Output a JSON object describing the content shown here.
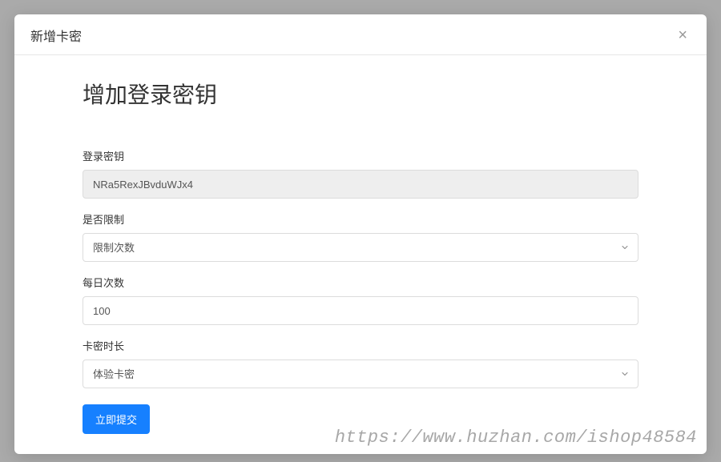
{
  "modal": {
    "title": "新增卡密"
  },
  "form": {
    "heading": "增加登录密钥",
    "fields": {
      "login_key": {
        "label": "登录密钥",
        "value": "NRa5RexJBvduWJx4"
      },
      "restriction": {
        "label": "是否限制",
        "selected": "限制次数"
      },
      "daily_count": {
        "label": "每日次数",
        "value": "100"
      },
      "card_duration": {
        "label": "卡密时长",
        "selected": "体验卡密"
      }
    },
    "submit_label": "立即提交"
  },
  "watermark": "https://www.huzhan.com/ishop48584"
}
